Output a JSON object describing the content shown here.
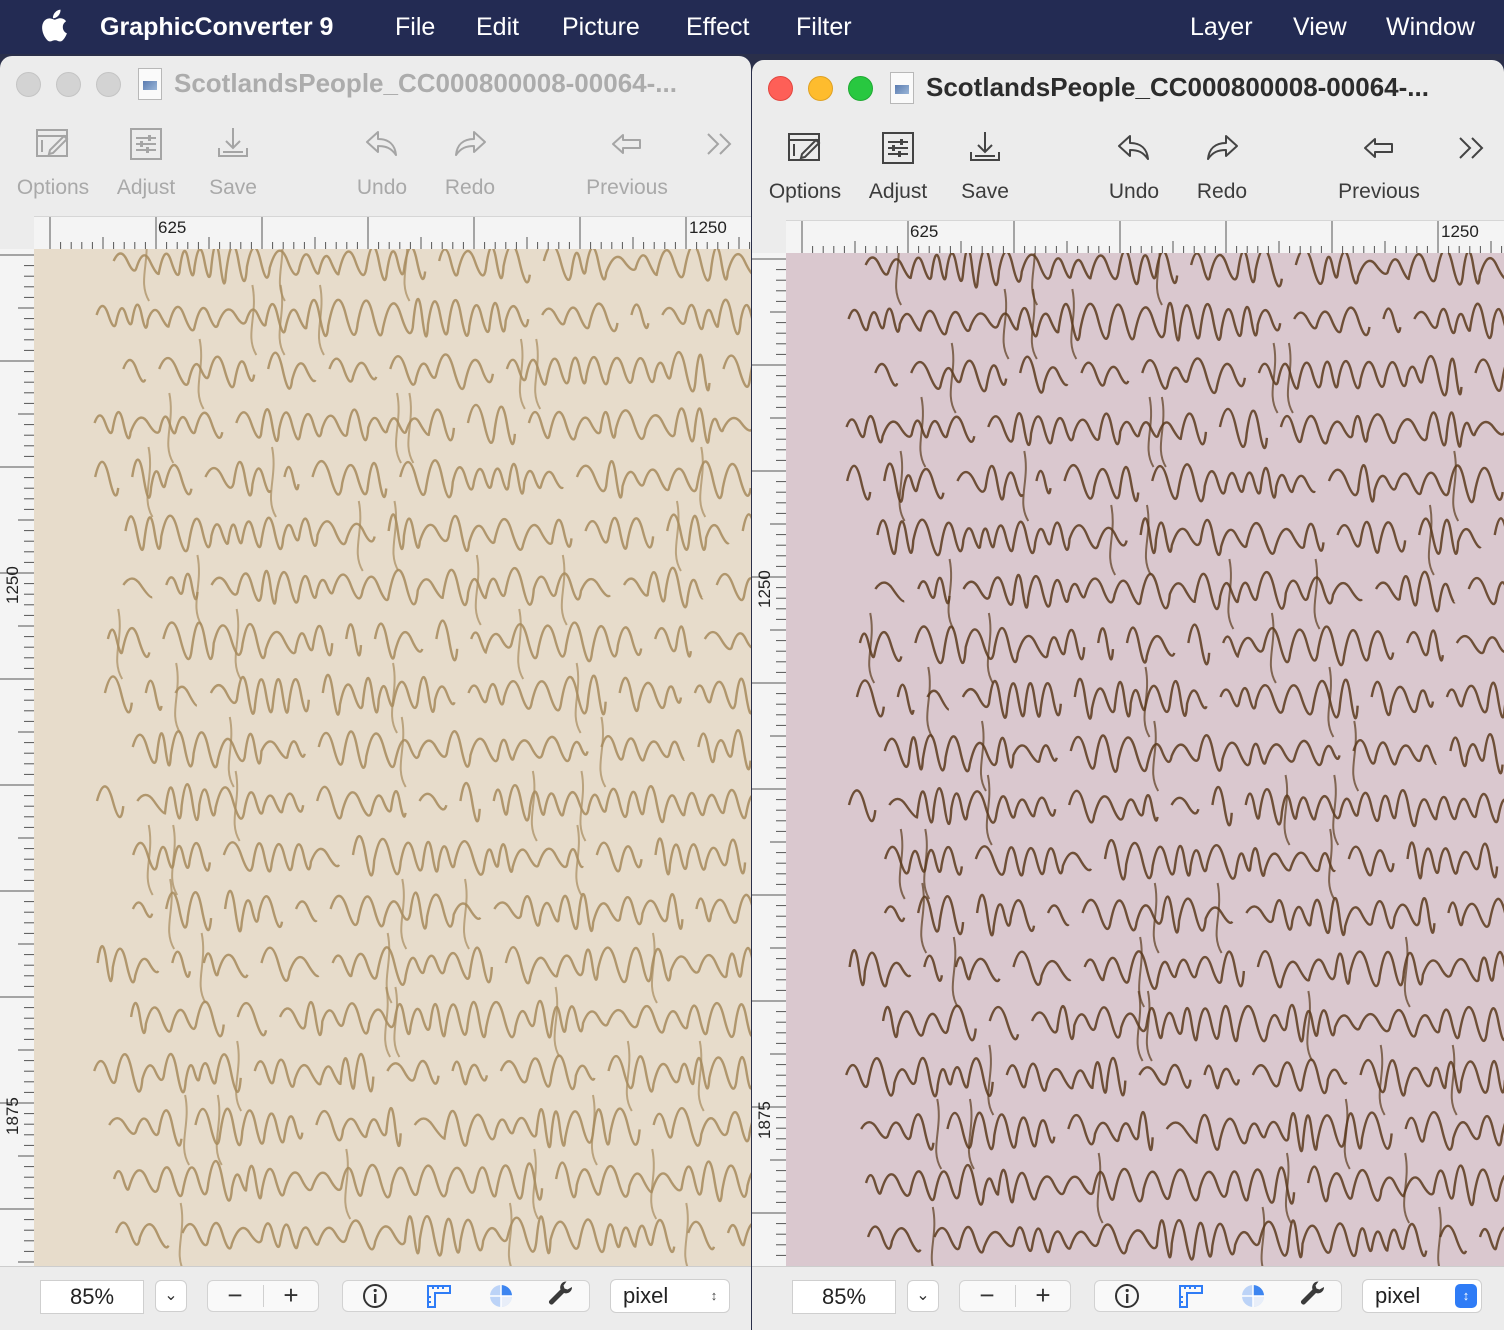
{
  "menubar": {
    "app_name": "GraphicConverter 9",
    "items": [
      "File",
      "Edit",
      "Picture",
      "Effect",
      "Filter",
      "Layer",
      "View",
      "Window"
    ]
  },
  "toolbar": {
    "options": "Options",
    "adjust": "Adjust",
    "save": "Save",
    "undo": "Undo",
    "redo": "Redo",
    "previous": "Previous"
  },
  "windows": {
    "left": {
      "title": "ScotlandsPeople_CC000800008-00064-...",
      "ruler_h": [
        "625",
        "1250"
      ],
      "ruler_v": [
        "1250",
        "1875"
      ],
      "zoom": "85%",
      "unit": "pixel"
    },
    "right": {
      "title": "ScotlandsPeople_CC000800008-00064-...",
      "ruler_h": [
        "625",
        "1250"
      ],
      "ruler_v": [
        "1250",
        "1875"
      ],
      "zoom": "85%",
      "unit": "pixel"
    }
  },
  "colors": {
    "menubar_bg": "#232b53",
    "left_paper": "#e7dccb",
    "left_ink": "#a68a5c",
    "right_paper": "#dac8cf",
    "right_ink": "#5a3a1c",
    "close": "#fe5f57",
    "minimize": "#febc2e",
    "zoom": "#28c840",
    "accent": "#2f7cf6"
  },
  "icons": [
    "apple-logo-icon",
    "options-icon",
    "adjust-icon",
    "save-icon",
    "undo-icon",
    "redo-icon",
    "previous-icon",
    "overflow-icon",
    "info-icon",
    "ruler-icon",
    "color-icon",
    "wrench-icon"
  ]
}
